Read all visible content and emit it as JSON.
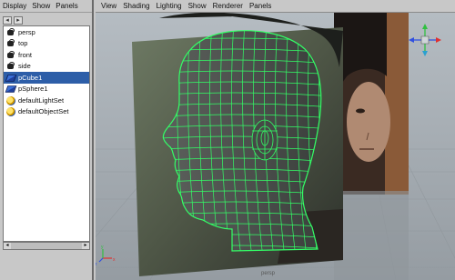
{
  "outliner": {
    "menu": [
      "Display",
      "Show",
      "Panels"
    ],
    "items": [
      {
        "label": "persp",
        "icon": "camera-icon",
        "selected": false
      },
      {
        "label": "top",
        "icon": "camera-icon",
        "selected": false
      },
      {
        "label": "front",
        "icon": "camera-icon",
        "selected": false
      },
      {
        "label": "side",
        "icon": "camera-icon",
        "selected": false
      },
      {
        "label": "pCube1",
        "icon": "mesh-icon",
        "selected": true
      },
      {
        "label": "pSphere1",
        "icon": "mesh-icon",
        "selected": false
      },
      {
        "label": "defaultLightSet",
        "icon": "set-icon",
        "selected": false
      },
      {
        "label": "defaultObjectSet",
        "icon": "set-icon",
        "selected": false
      }
    ]
  },
  "viewport": {
    "menu": [
      "View",
      "Shading",
      "Lighting",
      "Show",
      "Renderer",
      "Panels"
    ],
    "camera_label": "persp"
  },
  "colors": {
    "wireframe": "#33ff66",
    "selection": "#2d5ea8",
    "viewport_bg": "#a9b0b6"
  }
}
